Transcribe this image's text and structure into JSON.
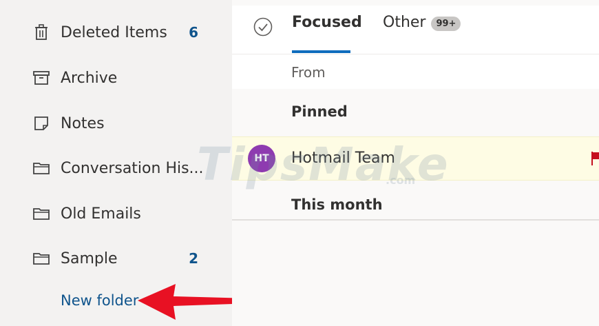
{
  "sidebar": {
    "items": [
      {
        "label": "Deleted Items",
        "icon": "trash-icon",
        "count": "6"
      },
      {
        "label": "Archive",
        "icon": "archive-icon",
        "count": ""
      },
      {
        "label": "Notes",
        "icon": "note-icon",
        "count": ""
      },
      {
        "label": "Conversation His...",
        "icon": "folder-icon",
        "count": ""
      },
      {
        "label": "Old Emails",
        "icon": "folder-icon",
        "count": ""
      },
      {
        "label": "Sample",
        "icon": "folder-icon",
        "count": "2"
      }
    ],
    "new_folder_label": "New folder"
  },
  "main": {
    "tabs": [
      {
        "label": "Focused",
        "active": true
      },
      {
        "label": "Other",
        "badge": "99+"
      }
    ],
    "from_label": "From",
    "groups": {
      "pinned": "Pinned",
      "this_month": "This month"
    },
    "messages": [
      {
        "initials": "HT",
        "sender": "Hotmail Team",
        "flagged": true
      }
    ]
  },
  "watermark": {
    "text": "TipsMake",
    "sub": ".com"
  },
  "colors": {
    "accent": "#0f6cbd",
    "count": "#0f548c",
    "avatar": "#8e3bb0",
    "flag": "#c50f1f",
    "pinned_row_bg": "#fefce4",
    "arrow": "#e81123"
  }
}
